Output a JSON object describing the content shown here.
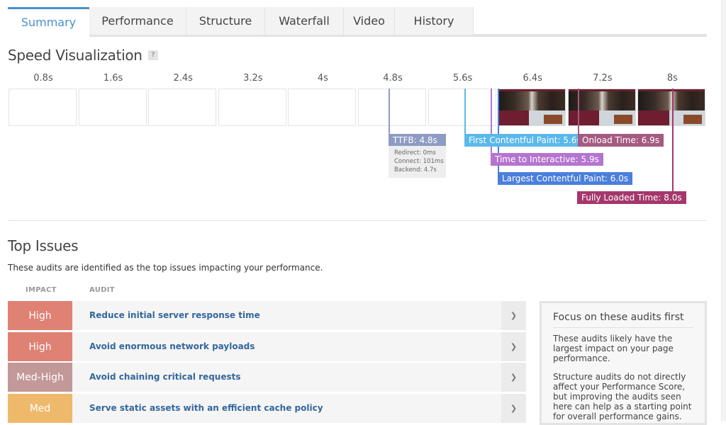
{
  "tabs": [
    {
      "label": "Summary",
      "active": true
    },
    {
      "label": "Performance"
    },
    {
      "label": "Structure"
    },
    {
      "label": "Waterfall"
    },
    {
      "label": "Video"
    },
    {
      "label": "History"
    }
  ],
  "speed_visualization": {
    "title": "Speed Visualization",
    "help_label": "?",
    "ticks": [
      "0.8s",
      "1.6s",
      "2.4s",
      "3.2s",
      "4s",
      "4.8s",
      "5.6s",
      "6.4s",
      "7.2s",
      "8s"
    ],
    "frames_rendered_from": "6.4s",
    "markers": {
      "ttfb": {
        "label": "TTFB: 4.8s",
        "value_s": 4.8,
        "color": "#8e9bc4"
      },
      "fcp": {
        "label": "First Contentful Paint: 5.6s",
        "value_s": 5.6,
        "color": "#5bb8ec"
      },
      "onload": {
        "label": "Onload Time: 6.9s",
        "value_s": 6.9,
        "color": "#a55a80"
      },
      "tti": {
        "label": "Time to Interactive: 5.9s",
        "value_s": 5.9,
        "color": "#b574cf"
      },
      "lcp": {
        "label": "Largest Contentful Paint: 6.0s",
        "value_s": 6.0,
        "color": "#4a7fdc"
      },
      "fully_loaded": {
        "label": "Fully Loaded Time: 8.0s",
        "value_s": 8.0,
        "color": "#a4386c"
      }
    },
    "ttfb_detail": [
      "Redirect: 0ms",
      "Connect: 101ms",
      "Backend: 4.7s"
    ]
  },
  "top_issues": {
    "title": "Top Issues",
    "subtitle": "These audits are identified as the top issues impacting your performance.",
    "columns": {
      "impact": "IMPACT",
      "audit": "AUDIT"
    },
    "rows": [
      {
        "impact": "High",
        "audit": "Reduce initial server response time",
        "color": "#df8173"
      },
      {
        "impact": "High",
        "audit": "Avoid enormous network payloads",
        "color": "#df8173"
      },
      {
        "impact": "Med-High",
        "audit": "Avoid chaining critical requests",
        "color": "#c39898"
      },
      {
        "impact": "Med",
        "audit": "Serve static assets with an efficient cache policy",
        "color": "#eeb96a"
      }
    ],
    "expand_icon": "chevron-down-icon"
  },
  "focus_box": {
    "title": "Focus on these audits first",
    "paragraphs": [
      "These audits likely have the largest impact on your page performance.",
      "Structure audits do not directly affect your Performance Score, but improving the audits seen here can help as a starting point for overall performance gains."
    ]
  }
}
